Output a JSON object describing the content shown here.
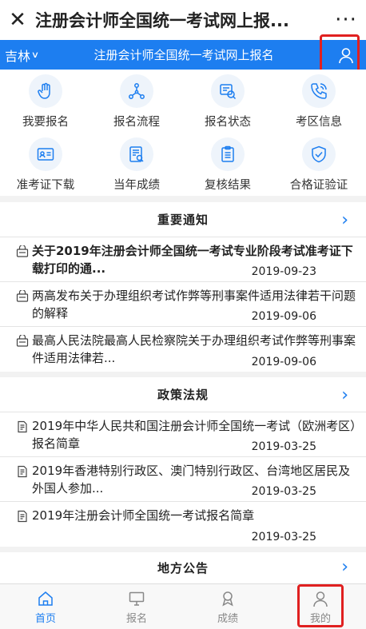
{
  "titlebar": {
    "close": "✕",
    "title": "注册会计师全国统一考试网上报...",
    "more": "···"
  },
  "bluebar": {
    "region": "吉林",
    "title": "注册会计师全国统一考试网上报名"
  },
  "grid": [
    {
      "label": "我要报名",
      "icon": "hand-icon"
    },
    {
      "label": "报名流程",
      "icon": "flow-icon"
    },
    {
      "label": "报名状态",
      "icon": "status-icon"
    },
    {
      "label": "考区信息",
      "icon": "phone-icon"
    },
    {
      "label": "准考证下载",
      "icon": "id-card-icon"
    },
    {
      "label": "当年成绩",
      "icon": "score-doc-icon"
    },
    {
      "label": "复核结果",
      "icon": "clipboard-icon"
    },
    {
      "label": "合格证验证",
      "icon": "shield-check-icon"
    }
  ],
  "notices": {
    "title": "重要通知",
    "items": [
      {
        "text": "关于2019年注册会计师全国统一考试专业阶段考试准考证下载打印的通...",
        "date": "2019-09-23",
        "bold": true
      },
      {
        "text": "两高发布关于办理组织考试作弊等刑事案件适用法律若干问题的解释",
        "date": "2019-09-06",
        "bold": false
      },
      {
        "text": "最高人民法院最高人民检察院关于办理组织考试作弊等刑事案件适用法律若...",
        "date": "2019-09-06",
        "bold": false
      }
    ]
  },
  "policies": {
    "title": "政策法规",
    "items": [
      {
        "text": "2019年中华人民共和国注册会计师全国统一考试（欧洲考区）报名简章",
        "date": "2019-03-25"
      },
      {
        "text": "2019年香港特别行政区、澳门特别行政区、台湾地区居民及外国人参加...",
        "date": "2019-03-25"
      },
      {
        "text": "2019年注册会计师全国统一考试报名简章",
        "date": "2019-03-25"
      }
    ]
  },
  "local": {
    "title": "地方公告"
  },
  "tabs": [
    {
      "label": "首页",
      "icon": "home-icon",
      "active": true
    },
    {
      "label": "报名",
      "icon": "monitor-icon",
      "active": false
    },
    {
      "label": "成绩",
      "icon": "award-icon",
      "active": false
    },
    {
      "label": "我的",
      "icon": "user-icon",
      "active": false
    }
  ],
  "colors": {
    "accent": "#1d7ef0",
    "highlight": "#e02020"
  }
}
